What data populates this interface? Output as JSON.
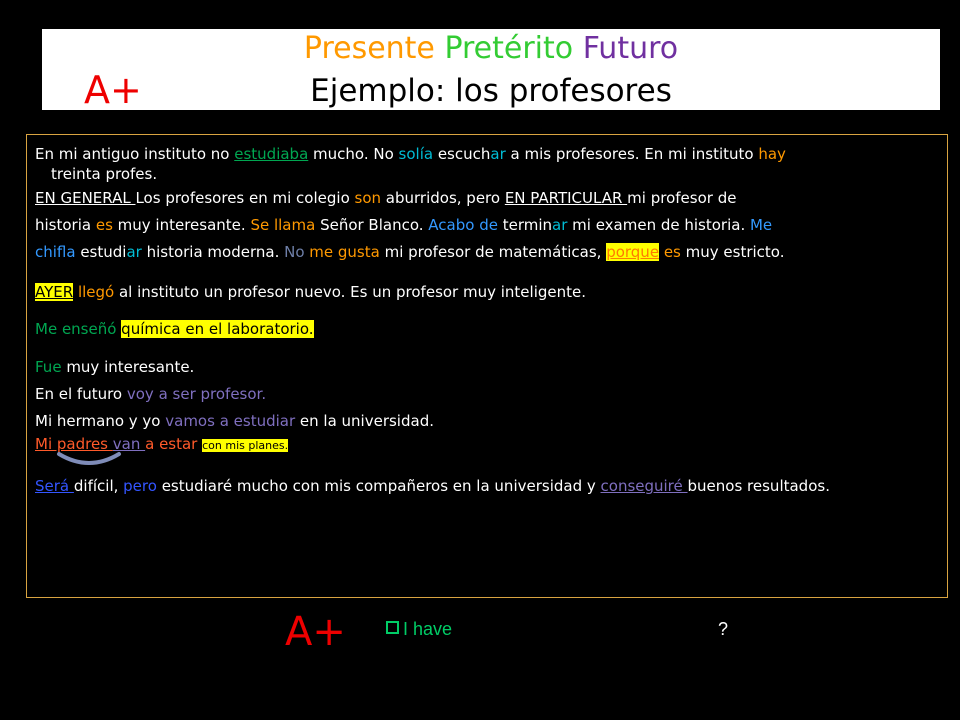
{
  "header": {
    "presente": "Presente",
    "preterito": "Pretérito",
    "futuro": "Futuro",
    "subtitle": "Ejemplo: los profesores",
    "grade": "A+"
  },
  "body": {
    "l1": [
      "En mi antiguo instituto no ",
      "estudiaba",
      " mucho. No ",
      "solía",
      "  escuch",
      "ar",
      " a mis profesores.  En mi instituto ",
      "hay"
    ],
    "l2": [
      "treinta profes."
    ],
    "l3": [
      "EN GENERAL ",
      "Los profesores en mi colegio ",
      "son",
      " aburridos, pero ",
      "EN PARTICULAR ",
      "mi profesor de"
    ],
    "l4": [
      "historia ",
      "es",
      " muy interesante. ",
      "Se llama",
      " Señor Blanco. ",
      "Acabo de",
      "  termin",
      "ar",
      " mi examen de historia. ",
      "Me"
    ],
    "l5": [
      "chifla",
      "  estudi",
      "ar",
      "  historia moderna.  ",
      "No",
      " me gusta",
      " mi profesor de matemáticas, ",
      "porque",
      " ",
      "es",
      " muy estricto."
    ],
    "l6": [
      "AYER",
      " llegó",
      " al instituto un profesor nuevo. Es un profesor muy inteligente."
    ],
    "l7": [
      "Me enseñó ",
      "química en el laboratorio."
    ],
    "l8": [
      "Fue",
      " muy interesante."
    ],
    "l9": [
      "En el futuro  ",
      "voy a ser profesor."
    ],
    "l10": [
      "Mi hermano y yo ",
      "vamos a estudiar",
      " en la universidad."
    ],
    "l11": [
      "Mi padres ",
      "van ",
      "a estar ",
      "con mis planes."
    ],
    "l12": [
      "Será ",
      "difícil, ",
      "pero",
      " estudiaré mucho con mis compañeros en la universidad y ",
      "conseguiré ",
      "buenos resultados."
    ]
  },
  "footer": {
    "grade": "A+",
    "bullet_text": "I have",
    "question_mark": "?"
  },
  "colors": {
    "presente": "#ff9900",
    "preterito": "#33cc33",
    "futuro": "#7030a0",
    "grade": "#ee0000",
    "panel_border": "#d9a441",
    "highlight": "#ffff00"
  }
}
